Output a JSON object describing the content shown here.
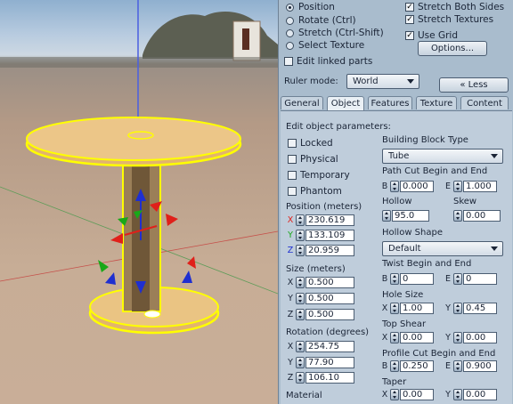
{
  "mode_radios": [
    {
      "label": "Position",
      "checked": true
    },
    {
      "label": "Rotate (Ctrl)",
      "checked": false
    },
    {
      "label": "Stretch (Ctrl-Shift)",
      "checked": false
    },
    {
      "label": "Select Texture",
      "checked": false
    }
  ],
  "stretch_options": {
    "stretch_both_sides": "Stretch Both Sides",
    "stretch_textures": "Stretch Textures",
    "use_grid": "Use Grid",
    "options_button": "Options...",
    "edit_linked": "Edit linked parts"
  },
  "ruler": {
    "label": "Ruler mode:",
    "value": "World"
  },
  "less_button": "« Less",
  "tabs": [
    "General",
    "Object",
    "Features",
    "Texture",
    "Content"
  ],
  "object": {
    "edit_params": "Edit object parameters:",
    "flags": [
      "Locked",
      "Physical",
      "Temporary",
      "Phantom"
    ],
    "position": {
      "label": "Position (meters)",
      "axes": [
        "X",
        "Y",
        "Z"
      ],
      "values": [
        "230.619",
        "133.109",
        "20.959"
      ]
    },
    "size": {
      "label": "Size (meters)",
      "axes": [
        "X",
        "Y",
        "Z"
      ],
      "values": [
        "0.500",
        "0.500",
        "0.500"
      ]
    },
    "rotation": {
      "label": "Rotation (degrees)",
      "axes": [
        "X",
        "Y",
        "Z"
      ],
      "values": [
        "254.75",
        "77.90",
        "106.10"
      ]
    },
    "material_label": "Material",
    "building_block": {
      "label": "Building Block Type",
      "value": "Tube"
    },
    "path_cut": {
      "label": "Path Cut Begin and End",
      "b_label": "B",
      "b": "0.000",
      "e_label": "E",
      "e": "1.000"
    },
    "hollow": {
      "label": "Hollow",
      "value": "95.0"
    },
    "skew": {
      "label": "Skew",
      "value": "0.00"
    },
    "hollow_shape": {
      "label": "Hollow Shape",
      "value": "Default"
    },
    "twist": {
      "label": "Twist Begin and End",
      "b_label": "B",
      "b": "0",
      "e_label": "E",
      "e": "0"
    },
    "hole_size": {
      "label": "Hole Size",
      "x_label": "X",
      "x": "1.00",
      "y_label": "Y",
      "y": "0.45"
    },
    "top_shear": {
      "label": "Top Shear",
      "x_label": "X",
      "x": "0.00",
      "y_label": "Y",
      "y": "0.00"
    },
    "profile_cut": {
      "label": "Profile Cut Begin and End",
      "b_label": "B",
      "b": "0.250",
      "e_label": "E",
      "e": "0.900"
    },
    "taper": {
      "label": "Taper",
      "x_label": "X",
      "x": "0.00",
      "y_label": "Y",
      "y": "0.00"
    }
  },
  "colors": {
    "panel": "#a9bccd",
    "selection": "#ffff00",
    "axis_x": "#e0201a",
    "axis_y": "#19a818",
    "axis_z": "#1f2fd0"
  }
}
